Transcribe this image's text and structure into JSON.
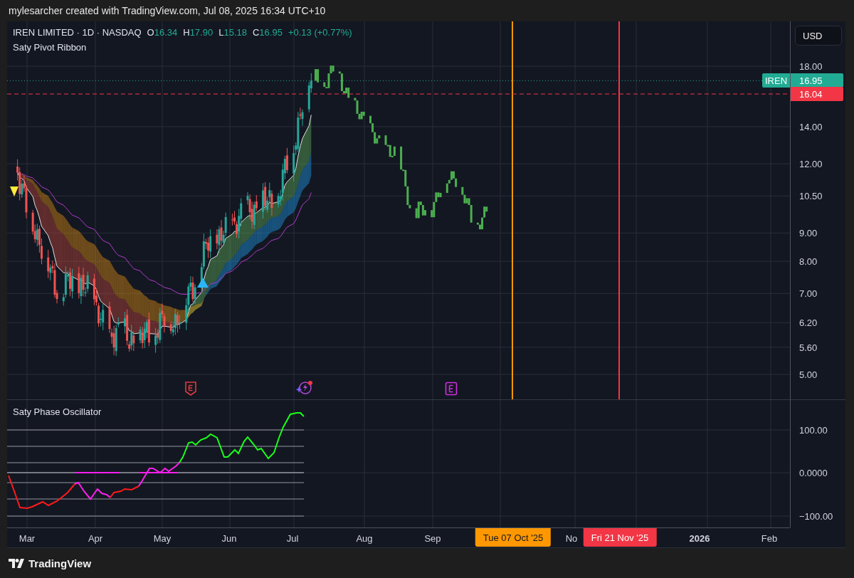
{
  "header": {
    "text": "mylesarcher created with TradingView.com, Jul 08, 2025 16:34 UTC+10"
  },
  "legend": {
    "symbol": "IREN LIMITED · 1D · NASDAQ",
    "ohlc": [
      {
        "key": "O",
        "value": "16.34"
      },
      {
        "key": "H",
        "value": "17.90"
      },
      {
        "key": "L",
        "value": "15.18"
      },
      {
        "key": "C",
        "value": "16.95"
      }
    ],
    "change": "+0.13 (+0.77%)"
  },
  "indicator_title": "Saty Pivot Ribbon",
  "currency": "USD",
  "price_axis": [
    "18.00",
    "14.00",
    "12.00",
    "10.50",
    "9.00",
    "8.00",
    "7.00",
    "6.20",
    "5.60",
    "5.00"
  ],
  "price_labels": [
    {
      "kind": "symbol",
      "name": "IREN",
      "value": "16.95"
    },
    {
      "kind": "level",
      "value": "16.04"
    }
  ],
  "oscillator": {
    "title": "Saty Phase Oscillator",
    "axis": [
      "100.00",
      "0.0000",
      "−100.00"
    ]
  },
  "time_axis": [
    {
      "label": "Mar",
      "kind": "month"
    },
    {
      "label": "Apr",
      "kind": "month"
    },
    {
      "label": "May",
      "kind": "month"
    },
    {
      "label": "Jun",
      "kind": "month"
    },
    {
      "label": "Jul",
      "kind": "month"
    },
    {
      "label": "Aug",
      "kind": "month"
    },
    {
      "label": "Sep",
      "kind": "month"
    },
    {
      "label": "No",
      "kind": "month"
    },
    {
      "label": "2026",
      "kind": "year"
    },
    {
      "label": "Feb",
      "kind": "month"
    }
  ],
  "markers": [
    {
      "label": "Tue 07 Oct '25",
      "color": "#ff9800"
    },
    {
      "label": "Fri 21 Nov '25",
      "color": "#f23645"
    }
  ],
  "footer": {
    "brand": "TradingView"
  }
}
